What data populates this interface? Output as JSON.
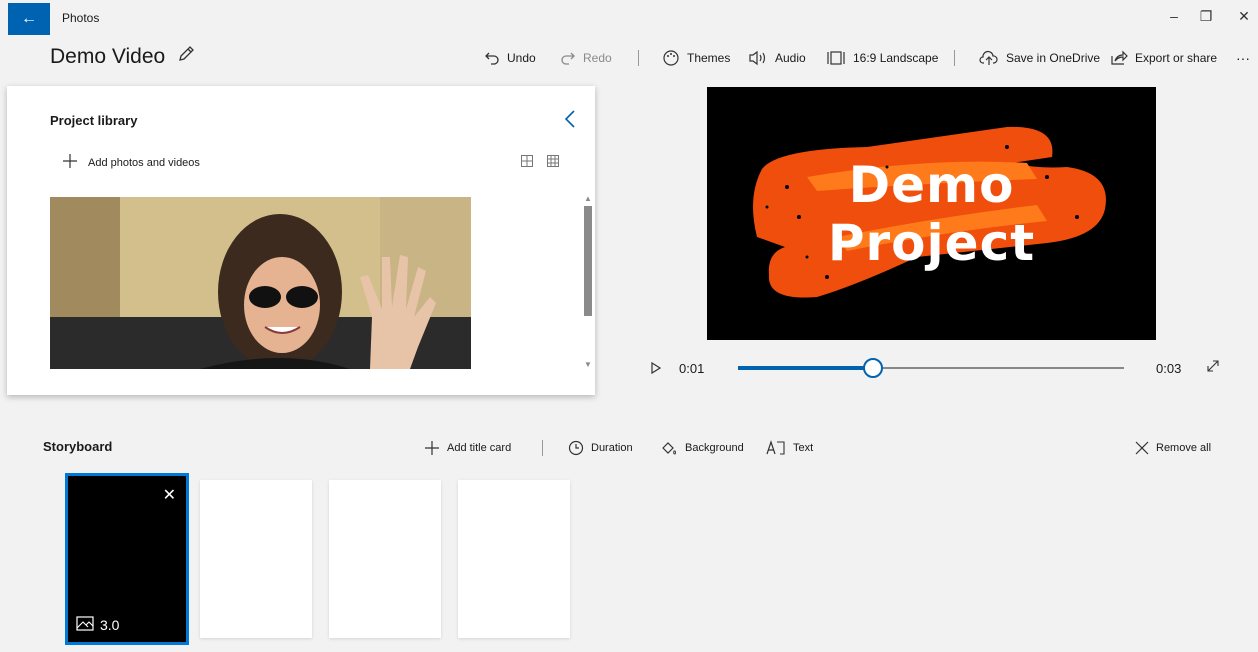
{
  "window": {
    "app_name": "Photos",
    "back_icon": "back-arrow-icon",
    "controls": [
      "minimize-icon",
      "restore-icon",
      "close-icon"
    ]
  },
  "header": {
    "project_title": "Demo Video",
    "edit_icon": "pencil-icon"
  },
  "toolbar": {
    "undo": "Undo",
    "redo": "Redo",
    "themes": "Themes",
    "audio": "Audio",
    "aspect": "16:9 Landscape",
    "save_onedrive": "Save in OneDrive",
    "export": "Export or share",
    "more": "···"
  },
  "library": {
    "title": "Project library",
    "add_label": "Add photos and videos",
    "collapse_icon": "chevron-left-icon",
    "view_icons": [
      "grid-large-icon",
      "grid-small-icon"
    ]
  },
  "preview": {
    "title_line1": "Demo",
    "title_line2": "Project",
    "current_time": "0:01",
    "end_time": "0:03",
    "progress_fraction": 0.35,
    "accent": "#0063b1",
    "brush_color": "#f04e0c"
  },
  "storyboard": {
    "title": "Storyboard",
    "add_title_card": "Add title card",
    "duration": "Duration",
    "background": "Background",
    "text": "Text",
    "remove_all": "Remove all",
    "cards": [
      {
        "duration": "3.0",
        "selected": true
      },
      {
        "duration": "",
        "selected": false
      },
      {
        "duration": "",
        "selected": false
      },
      {
        "duration": "",
        "selected": false
      }
    ]
  }
}
